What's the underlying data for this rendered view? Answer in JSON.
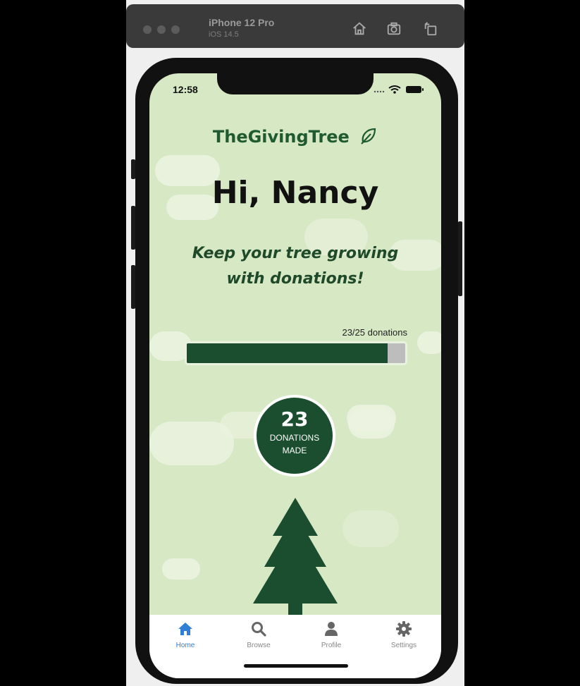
{
  "simulator": {
    "device_name": "iPhone 12 Pro",
    "os_version": "iOS 14.5",
    "toolbar_icons": [
      "home-icon",
      "screenshot-icon",
      "rotate-icon"
    ]
  },
  "status_bar": {
    "time": "12:58",
    "icons": [
      "signal-dots-icon",
      "wifi-icon",
      "battery-icon"
    ]
  },
  "app": {
    "brand": "TheGivingTree",
    "brand_icon": "leaf-icon",
    "greeting": "Hi, Nancy",
    "tagline": "Keep your tree growing with donations!",
    "progress": {
      "label": "23/25 donations",
      "current": 23,
      "goal": 25
    },
    "badge": {
      "count": "23",
      "line1": "DONATIONS",
      "line2": "MADE"
    },
    "tree_icon": "pine-tree-icon"
  },
  "tabs": [
    {
      "label": "Home",
      "icon": "home-icon",
      "active": true
    },
    {
      "label": "Browse",
      "icon": "search-icon",
      "active": false
    },
    {
      "label": "Profile",
      "icon": "user-icon",
      "active": false
    },
    {
      "label": "Settings",
      "icon": "gear-icon",
      "active": false
    }
  ],
  "colors": {
    "accent": "#1a4e2e",
    "screen_bg": "#d7e8c4",
    "active_tab": "#2f7fd6",
    "brand_text": "#1f5a30"
  }
}
